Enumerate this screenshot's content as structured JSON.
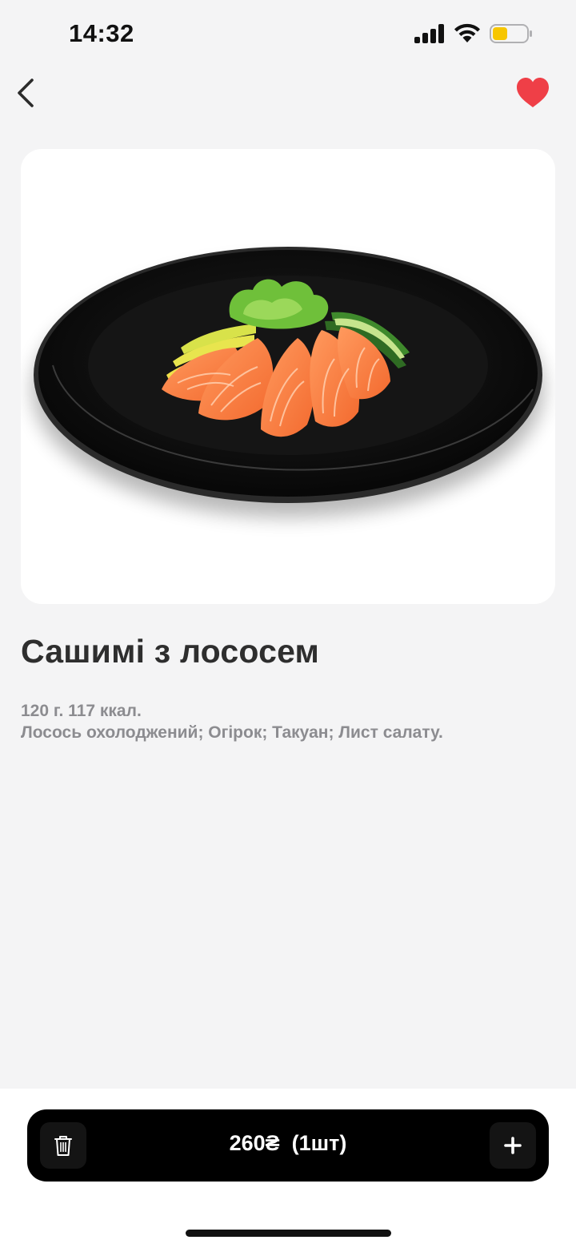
{
  "status_bar": {
    "time": "14:32",
    "battery_color": "#f7c600"
  },
  "nav": {
    "back_icon": "chevron-left-icon",
    "favorite_icon": "heart-icon",
    "favorite_color": "#ef3f47"
  },
  "product": {
    "image": "salmon-sashimi-on-black-plate",
    "title": "Сашимі з лососем",
    "weight_calories": "120 г. 117 ккал.",
    "ingredients": "Лосось охолоджений; Огірок; Такуан; Лист салату."
  },
  "cart": {
    "price": "260₴",
    "quantity": "(1шт)",
    "delete_icon": "trash-icon",
    "add_icon": "plus-icon"
  }
}
